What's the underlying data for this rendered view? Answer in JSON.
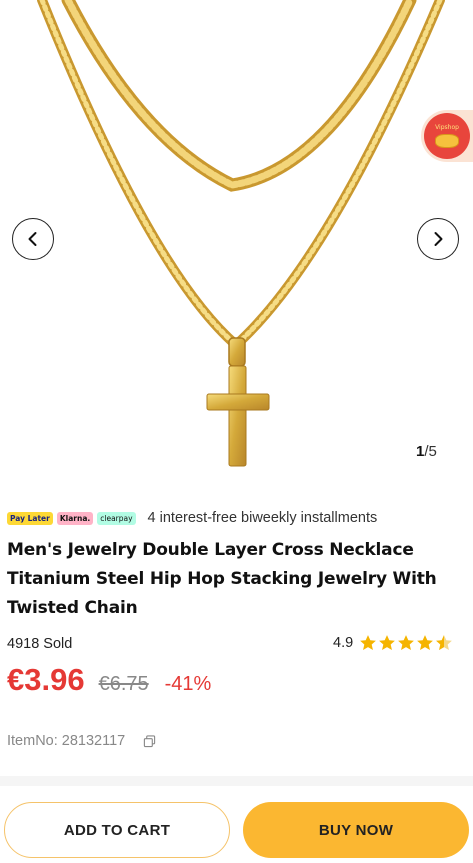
{
  "gallery": {
    "current": "1",
    "total": "/5",
    "prev_icon": "chevron-left-icon",
    "next_icon": "chevron-right-icon"
  },
  "vip_badge": {
    "text": "Vipshop"
  },
  "payment": {
    "logos": [
      "Pay Later",
      "Klarna.",
      "clearpay"
    ],
    "installments_text": "4 interest-free biweekly installments"
  },
  "product": {
    "title": "Men's Jewelry Double Layer Cross Necklace Titanium Steel Hip Hop Stacking Jewelry With Twisted Chain",
    "sold": "4918 Sold",
    "rating": "4.9",
    "rating_stars": 4.5,
    "price": "€3.96",
    "original_price": "€6.75",
    "discount": "-41%",
    "item_no": "ItemNo: 28132117"
  },
  "actions": {
    "add_to_cart": "ADD TO CART",
    "buy_now": "BUY NOW"
  },
  "colors": {
    "price_red": "#e53935",
    "buy_yellow": "#fbb731",
    "star_gold": "#f5b400",
    "gold": "#d4a93a"
  }
}
